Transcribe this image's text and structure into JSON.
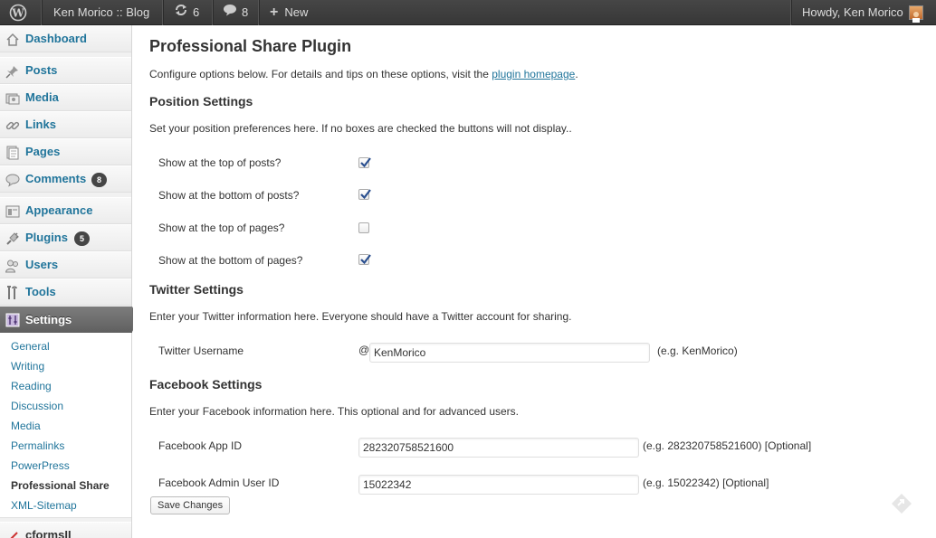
{
  "adminbar": {
    "site_name": "Ken Morico :: Blog",
    "updates_count": "6",
    "comments_count": "8",
    "new_label": "New",
    "howdy": "Howdy, Ken Morico",
    "icons": [
      "wordpress-logo-icon",
      "updates-icon",
      "comments-bubble-icon",
      "plus-icon",
      "avatar"
    ]
  },
  "sidebar": {
    "items": [
      {
        "label": "Dashboard",
        "icon": "dashboard-icon"
      },
      {
        "label": "Posts",
        "icon": "pushpin-icon"
      },
      {
        "label": "Media",
        "icon": "media-icon"
      },
      {
        "label": "Links",
        "icon": "chain-link-icon"
      },
      {
        "label": "Pages",
        "icon": "pages-icon"
      },
      {
        "label": "Comments",
        "icon": "comments-icon",
        "badge": "8"
      },
      {
        "label": "Appearance",
        "icon": "appearance-icon"
      },
      {
        "label": "Plugins",
        "icon": "plug-icon",
        "badge": "5"
      },
      {
        "label": "Users",
        "icon": "users-icon"
      },
      {
        "label": "Tools",
        "icon": "tools-icon"
      },
      {
        "label": "Settings",
        "icon": "settings-icon"
      }
    ],
    "submenu": [
      "General",
      "Writing",
      "Reading",
      "Discussion",
      "Media",
      "Permalinks",
      "PowerPress",
      "Professional Share",
      "XML-Sitemap"
    ],
    "cut_item": "cformsII"
  },
  "main": {
    "title": "Professional Share Plugin",
    "intro_text": "Configure options below. For details and tips on these options, visit the ",
    "intro_link": "plugin homepage",
    "intro_end": ".",
    "position": {
      "heading": "Position Settings",
      "desc": "Set your position preferences here. If no boxes are checked the buttons will not display..",
      "options": [
        {
          "label": "Show at the top of posts?",
          "checked": true
        },
        {
          "label": "Show at the bottom of posts?",
          "checked": true
        },
        {
          "label": "Show at the top of pages?",
          "checked": false
        },
        {
          "label": "Show at the bottom of pages?",
          "checked": true
        }
      ]
    },
    "twitter": {
      "heading": "Twitter Settings",
      "desc": "Enter your Twitter information here. Everyone should have a Twitter account for sharing.",
      "username_label": "Twitter Username",
      "at_sign": "@",
      "username_value": "KenMorico",
      "username_hint": "(e.g. KenMorico)"
    },
    "facebook": {
      "heading": "Facebook Settings",
      "desc": "Enter your Facebook information here. This optional and for advanced users.",
      "app_id_label": "Facebook App ID",
      "app_id_value": "282320758521600",
      "app_id_hint": "(e.g. 282320758521600) [Optional]",
      "admin_label": "Facebook Admin User ID",
      "admin_value": "15022342",
      "admin_hint": "(e.g. 15022342) [Optional]"
    },
    "save_label": "Save Changes"
  },
  "colors": {
    "link": "#21759b",
    "adminbar": "#464646",
    "current_menu": "#6d6d6d"
  }
}
